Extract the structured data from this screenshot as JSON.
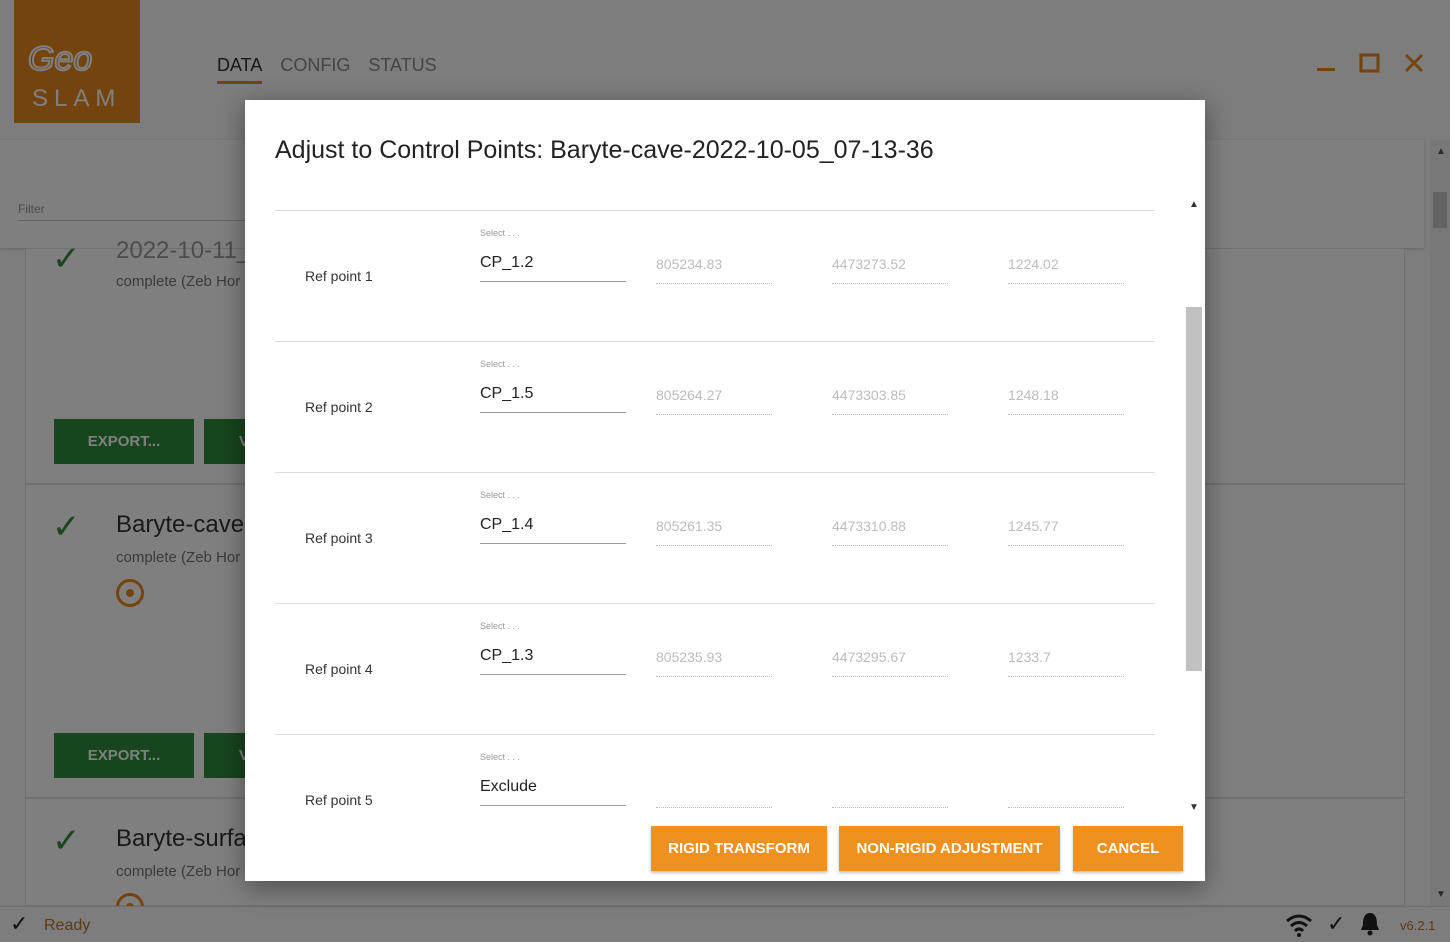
{
  "app": {
    "logo_text_top": "Geo",
    "logo_text_bottom": "SLAM",
    "tabs": [
      "DATA",
      "CONFIG",
      "STATUS"
    ],
    "filter_label": "Filter",
    "version": "v6.2.1",
    "status_text": "Ready",
    "accent_color": "#e8891e",
    "green_color": "#2e8b3a"
  },
  "cards": [
    {
      "title": "2022-10-11_",
      "status": "complete (Zeb Hor",
      "export_label": "EXPORT...",
      "view_label": "V"
    },
    {
      "title": "Baryte-cave",
      "status": "complete (Zeb Hor",
      "export_label": "EXPORT...",
      "view_label": "V"
    },
    {
      "title": "Baryte-surfa",
      "status": "complete (Zeb Hor"
    }
  ],
  "dialog": {
    "title": "Adjust to Control Points: Baryte-cave-2022-10-05_07-13-36",
    "select_caption": "Select . . .",
    "rows": [
      {
        "label": "Ref point 1",
        "selected": "CP_1.2",
        "x": "805234.83",
        "y": "4473273.52",
        "z": "1224.02"
      },
      {
        "label": "Ref point 2",
        "selected": "CP_1.5",
        "x": "805264.27",
        "y": "4473303.85",
        "z": "1248.18"
      },
      {
        "label": "Ref point 3",
        "selected": "CP_1.4",
        "x": "805261.35",
        "y": "4473310.88",
        "z": "1245.77"
      },
      {
        "label": "Ref point 4",
        "selected": "CP_1.3",
        "x": "805235.93",
        "y": "4473295.67",
        "z": "1233.7"
      },
      {
        "label": "Ref point 5",
        "selected": "Exclude",
        "x": "",
        "y": "",
        "z": ""
      }
    ],
    "buttons": {
      "rigid": "RIGID TRANSFORM",
      "nonrigid": "NON-RIGID ADJUSTMENT",
      "cancel": "CANCEL"
    }
  }
}
